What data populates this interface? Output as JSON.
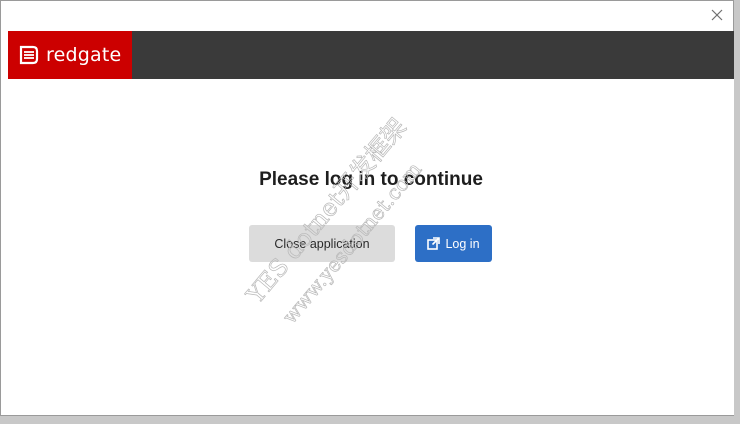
{
  "window": {
    "close_icon": "close-icon"
  },
  "header": {
    "logo_text": "redgate",
    "logo_icon": "redgate-logo-icon",
    "brand_color": "#cc0000",
    "bar_color": "#3a3a3a"
  },
  "main": {
    "heading": "Please log in to continue",
    "close_button_label": "Close application",
    "login_button_label": "Log in",
    "login_icon": "external-link-icon",
    "login_color": "#2d6fc6"
  },
  "watermark": {
    "line1": "YES dotnet开发框架",
    "line2": "www.yesdotnet.com"
  }
}
